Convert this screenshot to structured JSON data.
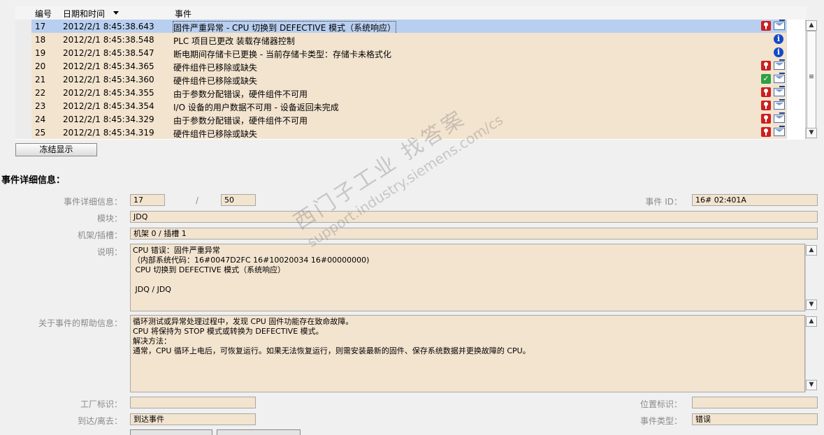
{
  "table": {
    "headers": {
      "num": "编号",
      "datetime": "日期和时间",
      "event": "事件"
    },
    "rows": [
      {
        "num": "17",
        "datetime": "2012/2/1 8:45:38.643",
        "event": "固件严重异常 - CPU 切换到 DEFECTIVE 模式（系统响应）",
        "icon": "error-icon",
        "ack": true,
        "selected": true
      },
      {
        "num": "18",
        "datetime": "2012/2/1 8:45:38.548",
        "event": "PLC 项目已更改 装载存储器控制",
        "icon": "info-icon",
        "ack": false
      },
      {
        "num": "19",
        "datetime": "2012/2/1 8:45:38.547",
        "event": "断电期间存储卡已更换 - 当前存储卡类型：存储卡未格式化",
        "icon": "info-icon",
        "ack": false
      },
      {
        "num": "20",
        "datetime": "2012/2/1 8:45:34.365",
        "event": "硬件组件已移除或缺失",
        "icon": "error-icon",
        "ack": true
      },
      {
        "num": "21",
        "datetime": "2012/2/1 8:45:34.360",
        "event": "硬件组件已移除或缺失",
        "icon": "ok-icon",
        "ack": true
      },
      {
        "num": "22",
        "datetime": "2012/2/1 8:45:34.355",
        "event": "由于参数分配错误，硬件组件不可用",
        "icon": "error-icon",
        "ack": true
      },
      {
        "num": "23",
        "datetime": "2012/2/1 8:45:34.354",
        "event": "I/O 设备的用户数据不可用 - 设备返回未完成",
        "icon": "error-icon",
        "ack": true
      },
      {
        "num": "24",
        "datetime": "2012/2/1 8:45:34.329",
        "event": "由于参数分配错误，硬件组件不可用",
        "icon": "error-icon",
        "ack": true
      },
      {
        "num": "25",
        "datetime": "2012/2/1 8:45:34.319",
        "event": "硬件组件已移除或缺失",
        "icon": "error-icon",
        "ack": true
      }
    ]
  },
  "freeze_button": "冻结显示",
  "details": {
    "title": "事件详细信息：",
    "labels": {
      "event_details": "事件详细信息：",
      "event_id": "事件 ID：",
      "module": "模块：",
      "rack_slot": "机架/插槽：",
      "description": "说明：",
      "help": "关于事件的帮助信息：",
      "plant_id": "工厂标识：",
      "location_id": "位置标识：",
      "incoming_outgoing": "到达/离去：",
      "event_type": "事件类型："
    },
    "event_index": "17",
    "separator": "/",
    "event_total": "50",
    "event_id": "16# 02:401A",
    "module": "JDQ",
    "rack_slot": "机架 0 / 插槽 1",
    "description_lines": [
      "CPU 错误：固件严重异常",
      "（内部系统代码：16#0047D2FC 16#10020034 16#00000000)",
      " CPU 切换到 DEFECTIVE 模式（系统响应）",
      "",
      " JDQ / JDQ"
    ],
    "help_lines": [
      "循环测试或异常处理过程中，发现 CPU 固件功能存在致命故障。",
      "CPU 将保持为 STOP 模式或转换为 DEFECTIVE 模式。",
      "解决方法：",
      "通常，CPU 循环上电后，可恢复运行。如果无法恢复运行，则需安装最新的固件、保存系统数据并更换故障的 CPU。"
    ],
    "plant_id": "",
    "location_id": "",
    "incoming_outgoing": "到达事件",
    "event_type": "错误"
  },
  "watermark": {
    "line1": "西门子工业  找答案",
    "line2": "support.industry.siemens.com/cs"
  },
  "colors": {
    "row_bg": "#f3e4cf",
    "selected_bg": "#b8cff0",
    "error": "#cc1f1f",
    "info": "#1449c9",
    "ok": "#2ea043"
  }
}
